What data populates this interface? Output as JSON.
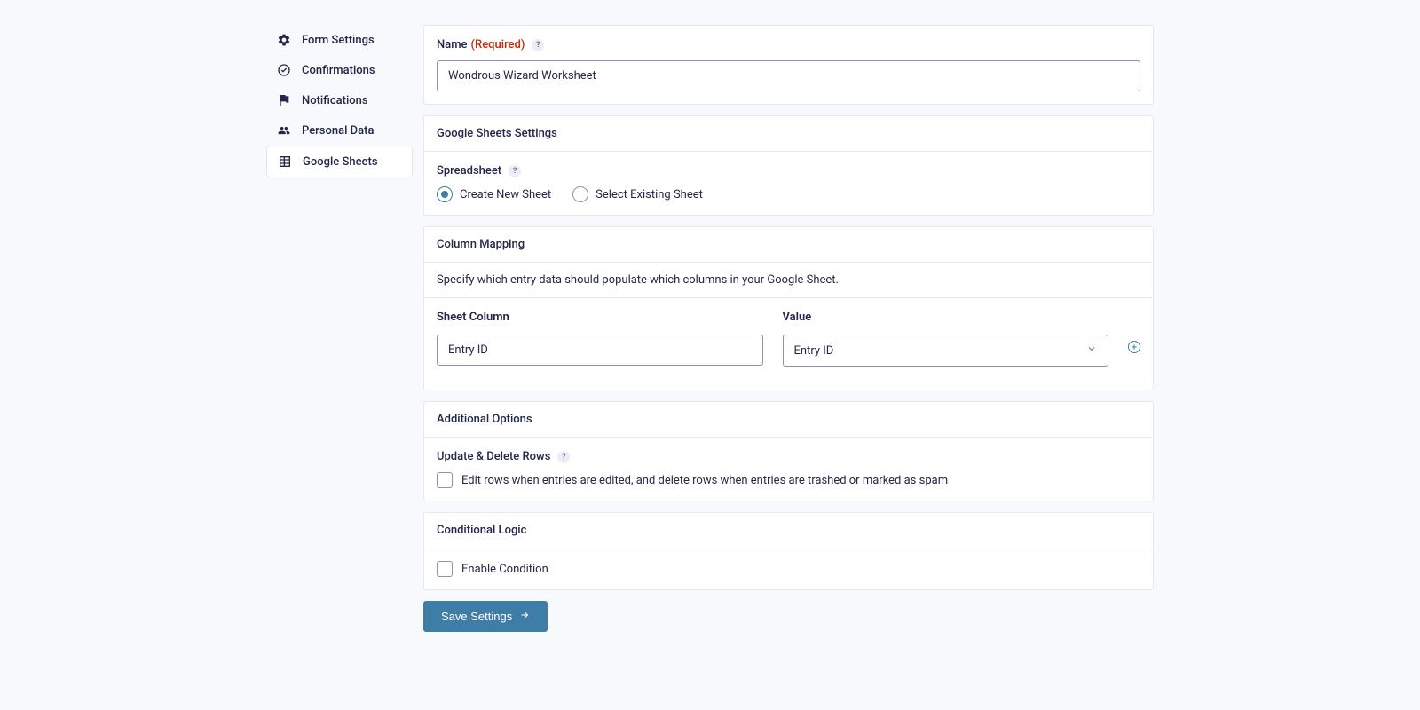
{
  "sidebar": {
    "items": [
      {
        "label": "Form Settings",
        "icon": "gear"
      },
      {
        "label": "Confirmations",
        "icon": "check-circle"
      },
      {
        "label": "Notifications",
        "icon": "flag"
      },
      {
        "label": "Personal Data",
        "icon": "people"
      },
      {
        "label": "Google Sheets",
        "icon": "grid",
        "active": true
      }
    ]
  },
  "name_section": {
    "label": "Name",
    "required_text": "(Required)",
    "value": "Wondrous Wizard Worksheet"
  },
  "sheets_section": {
    "header": "Google Sheets Settings",
    "spreadsheet_label": "Spreadsheet",
    "options": {
      "create": "Create New Sheet",
      "select": "Select Existing Sheet"
    },
    "selected": "create"
  },
  "mapping_section": {
    "header": "Column Mapping",
    "description": "Specify which entry data should populate which columns in your Google Sheet.",
    "sheet_col_label": "Sheet Column",
    "value_label": "Value",
    "rows": [
      {
        "column": "Entry ID",
        "value": "Entry ID"
      }
    ]
  },
  "additional_section": {
    "header": "Additional Options",
    "update_label": "Update & Delete Rows",
    "update_text": "Edit rows when entries are edited, and delete rows when entries are trashed or marked as spam"
  },
  "conditional_section": {
    "header": "Conditional Logic",
    "enable_text": "Enable Condition"
  },
  "save_label": "Save Settings"
}
